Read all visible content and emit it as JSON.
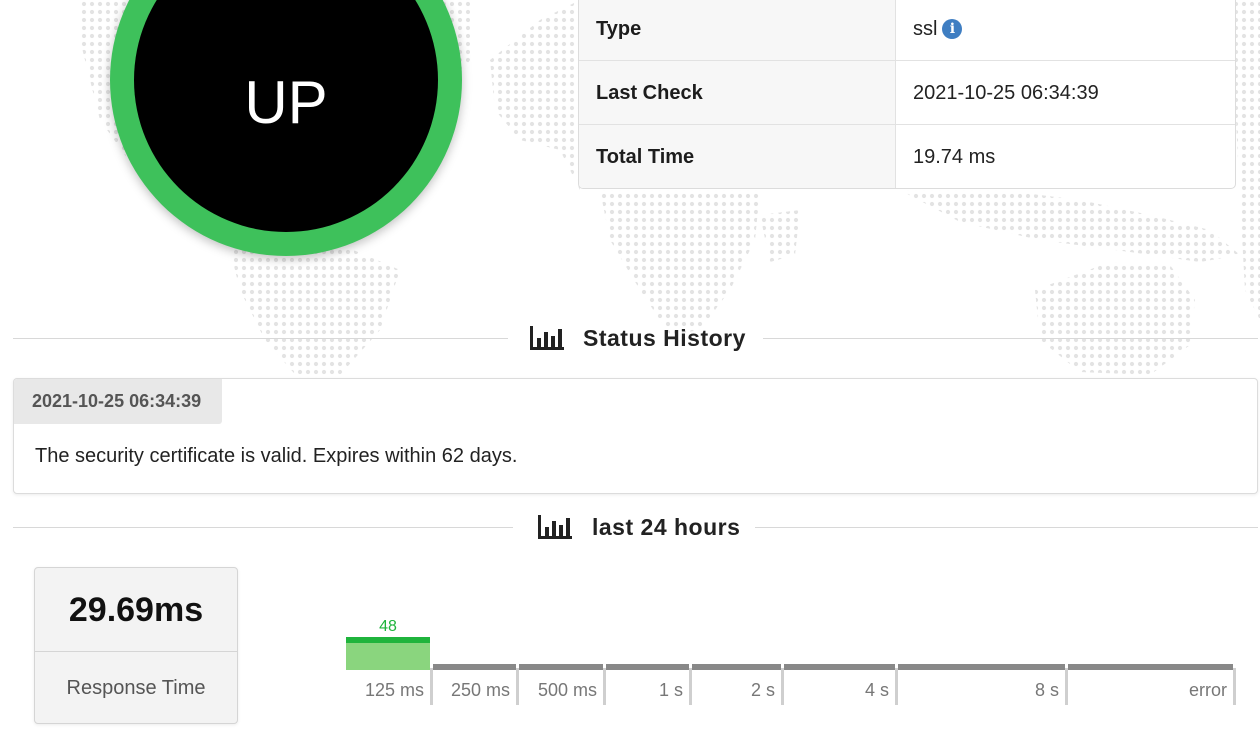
{
  "status": {
    "label": "UP",
    "ring_color": "#3ec15b"
  },
  "info": {
    "rows": [
      {
        "key": "Type",
        "value": "ssl",
        "icon": "info-icon"
      },
      {
        "key": "Last Check",
        "value": "2021-10-25 06:34:39"
      },
      {
        "key": "Total Time",
        "value": "19.74 ms"
      }
    ]
  },
  "sections": {
    "status_history": {
      "title": "Status History",
      "icon": "bar-chart-icon"
    },
    "last_24h": {
      "title": "last 24 hours",
      "icon": "bar-chart-icon"
    }
  },
  "history": [
    {
      "timestamp": "2021-10-25 06:34:39",
      "message": "The security certificate is valid. Expires within 62 days."
    }
  ],
  "response_time": {
    "value": "29.69ms",
    "label": "Response Time"
  },
  "histogram": {
    "accent": "#1fb43c",
    "fill": "#8ad57e",
    "bins": [
      {
        "label": "125 ms",
        "count": "48",
        "active": true
      },
      {
        "label": "250 ms",
        "count": "",
        "active": false
      },
      {
        "label": "500 ms",
        "count": "",
        "active": false
      },
      {
        "label": "1 s",
        "count": "",
        "active": false
      },
      {
        "label": "2 s",
        "count": "",
        "active": false
      },
      {
        "label": "4 s",
        "count": "",
        "active": false
      },
      {
        "label": "8 s",
        "count": "",
        "active": false
      },
      {
        "label": "error",
        "count": "",
        "active": false
      }
    ]
  }
}
